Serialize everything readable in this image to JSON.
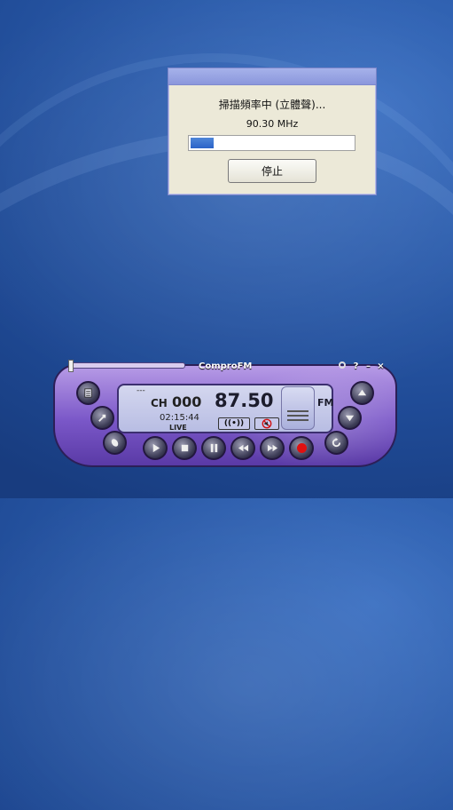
{
  "dialog": {
    "message": "掃描頻率中 (立體聲)...",
    "frequency": "90.30 MHz",
    "progress_fraction": 0.14,
    "stop_label": "停止"
  },
  "player": {
    "title": "ComproFM",
    "window_controls": [
      "ring-icon",
      "?",
      "–",
      "×"
    ],
    "lcd": {
      "dashes": "---",
      "channel_label": "CH",
      "channel_number": "000",
      "frequency": "87.50",
      "band": "FM",
      "time": "02:15:44",
      "mode": "LIVE",
      "stereo_label": "((•))"
    },
    "left_buttons": [
      "playlist-icon",
      "scan-icon",
      "skin-icon"
    ],
    "right_buttons": [
      "channel-up-icon",
      "channel-down-icon",
      "return-icon"
    ],
    "transport": [
      "play-icon",
      "stop-icon",
      "pause-icon",
      "rewind-icon",
      "fast-forward-icon",
      "record-icon"
    ],
    "colors": {
      "shell": "#7a57c8",
      "lcd": "#c6c9ea",
      "record": "#e01010"
    }
  }
}
